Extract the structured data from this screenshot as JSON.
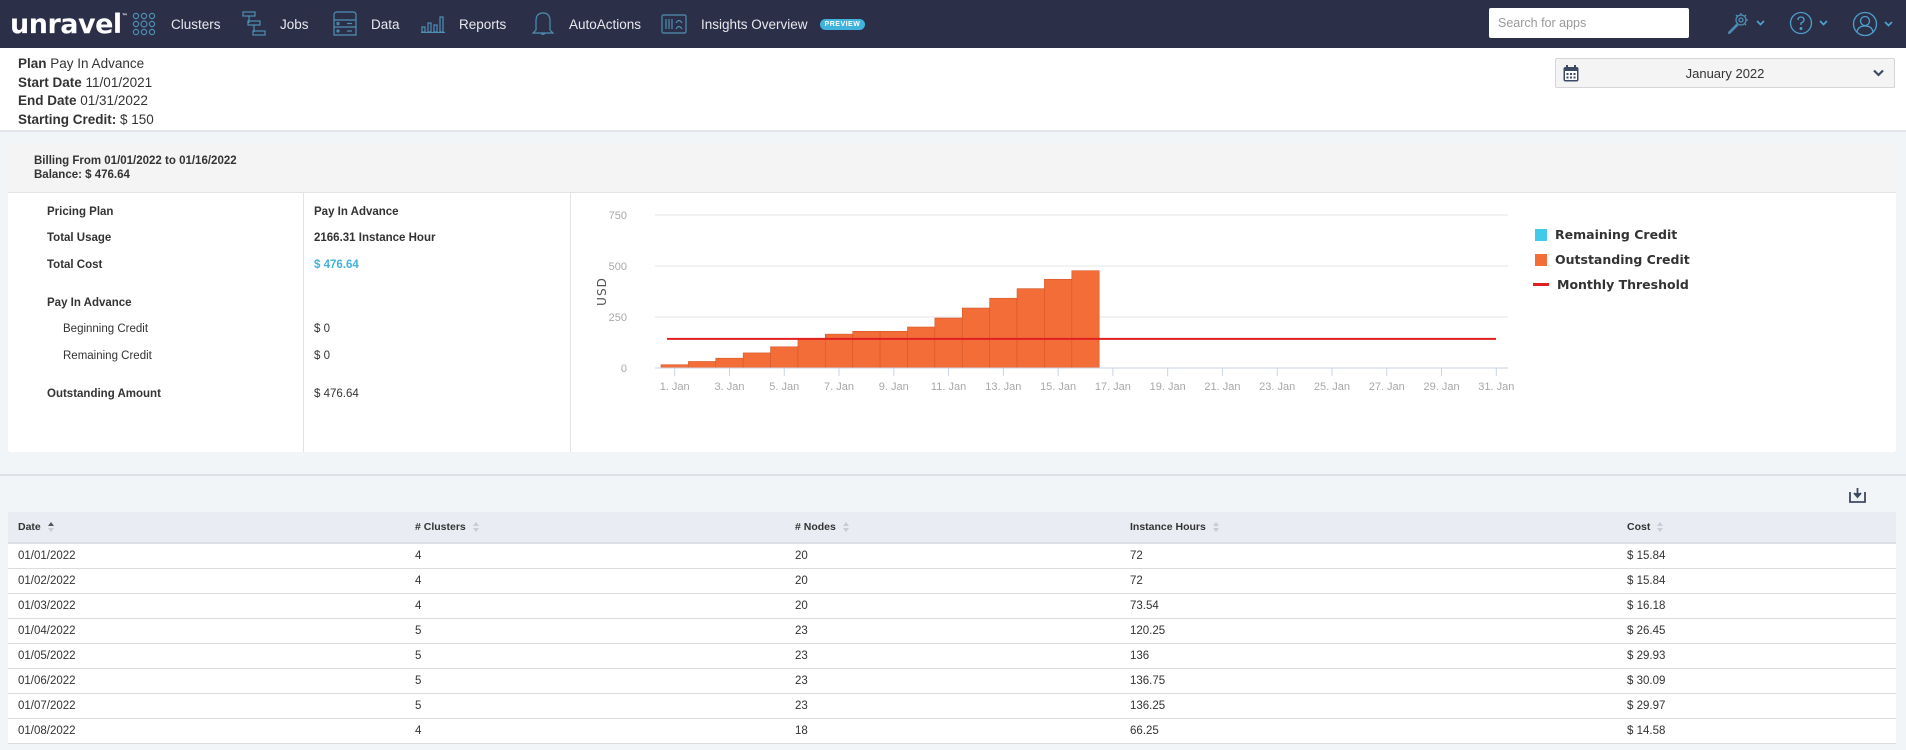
{
  "nav": {
    "logo": "unravel",
    "items": [
      {
        "label": "Clusters",
        "icon": "clusters-icon"
      },
      {
        "label": "Jobs",
        "icon": "jobs-icon"
      },
      {
        "label": "Data",
        "icon": "data-icon"
      },
      {
        "label": "Reports",
        "icon": "reports-icon"
      },
      {
        "label": "AutoActions",
        "icon": "bell-icon"
      },
      {
        "label": "Insights Overview",
        "icon": "insights-icon",
        "badge": "PREVIEW"
      }
    ],
    "search_placeholder": "Search for apps",
    "right_icons": [
      "settings-icon",
      "help-icon",
      "user-icon"
    ]
  },
  "plan": {
    "plan_label": "Plan",
    "plan_value": "Pay In Advance",
    "start_label": "Start Date",
    "start_value": "11/01/2021",
    "end_label": "End Date",
    "end_value": "01/31/2022",
    "credit_label": "Starting Credit:",
    "credit_value": "$ 150"
  },
  "date_selector": {
    "value": "January 2022"
  },
  "billing": {
    "range": "Billing From 01/01/2022 to 01/16/2022",
    "balance": "Balance: $ 476.64"
  },
  "summary": {
    "pricing_plan_label": "Pricing Plan",
    "pricing_plan_value": "Pay In Advance",
    "total_usage_label": "Total Usage",
    "total_usage_value": "2166.31 Instance Hour",
    "total_cost_label": "Total Cost",
    "total_cost_value": "$ 476.64",
    "pay_in_advance_label": "Pay In Advance",
    "beginning_credit_label": "Beginning Credit",
    "beginning_credit_value": "$ 0",
    "remaining_credit_label": "Remaining Credit",
    "remaining_credit_value": "$ 0",
    "outstanding_label": "Outstanding Amount",
    "outstanding_value": "$ 476.64"
  },
  "colors": {
    "nav_bg": "#2b2f48",
    "accent": "#40b3dc",
    "remaining_credit": "#42cbe8",
    "outstanding_credit": "#f26d38",
    "threshold": "#e02020"
  },
  "chart_data": {
    "type": "bar",
    "title": "",
    "xlabel": "",
    "ylabel": "USD",
    "ylim": [
      0,
      750
    ],
    "yticks": [
      0,
      250,
      500,
      750
    ],
    "xticks": [
      "1. Jan",
      "3. Jan",
      "5. Jan",
      "7. Jan",
      "9. Jan",
      "11. Jan",
      "13. Jan",
      "15. Jan",
      "17. Jan",
      "19. Jan",
      "21. Jan",
      "23. Jan",
      "25. Jan",
      "27. Jan",
      "29. Jan",
      "31. Jan"
    ],
    "x_days": [
      1,
      31
    ],
    "grid": true,
    "legend_position": "right",
    "legend": [
      "Remaining Credit",
      "Outstanding Credit",
      "Monthly Threshold"
    ],
    "categories": [
      "1. Jan",
      "2. Jan",
      "3. Jan",
      "4. Jan",
      "5. Jan",
      "6. Jan",
      "7. Jan",
      "8. Jan",
      "9. Jan",
      "10. Jan",
      "11. Jan",
      "12. Jan",
      "13. Jan",
      "14. Jan",
      "15. Jan",
      "16. Jan"
    ],
    "series": [
      {
        "name": "Remaining Credit",
        "values": [
          0,
          0,
          0,
          0,
          0,
          0,
          0,
          0,
          0,
          0,
          0,
          0,
          0,
          0,
          0,
          0
        ]
      },
      {
        "name": "Outstanding Credit",
        "values": [
          16,
          32,
          48,
          74,
          104,
          141,
          166,
          180,
          180,
          201,
          245,
          294,
          342,
          389,
          435,
          477
        ]
      },
      {
        "name": "Monthly Threshold",
        "type": "line",
        "value": 143
      }
    ]
  },
  "table": {
    "download_icon": "download-icon",
    "columns": [
      "Date",
      "# Clusters",
      "# Nodes",
      "Instance Hours",
      "Cost"
    ],
    "rows": [
      [
        "01/01/2022",
        "4",
        "20",
        "72",
        "$ 15.84"
      ],
      [
        "01/02/2022",
        "4",
        "20",
        "72",
        "$ 15.84"
      ],
      [
        "01/03/2022",
        "4",
        "20",
        "73.54",
        "$ 16.18"
      ],
      [
        "01/04/2022",
        "5",
        "23",
        "120.25",
        "$ 26.45"
      ],
      [
        "01/05/2022",
        "5",
        "23",
        "136",
        "$ 29.93"
      ],
      [
        "01/06/2022",
        "5",
        "23",
        "136.75",
        "$ 30.09"
      ],
      [
        "01/07/2022",
        "5",
        "23",
        "136.25",
        "$ 29.97"
      ],
      [
        "01/08/2022",
        "4",
        "18",
        "66.25",
        "$ 14.58"
      ]
    ]
  }
}
